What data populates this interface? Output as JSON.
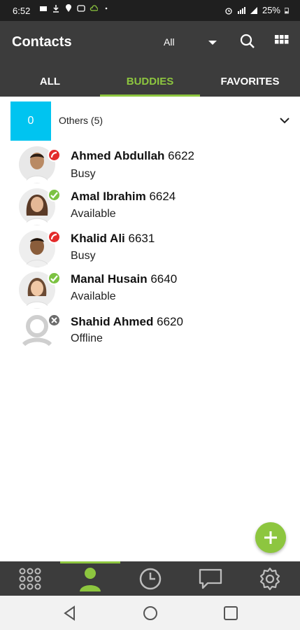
{
  "status_bar": {
    "time": "6:52",
    "battery": "25%"
  },
  "app_bar": {
    "title": "Contacts",
    "filter_value": "All"
  },
  "tabs": [
    {
      "label": "ALL"
    },
    {
      "label": "BUDDIES"
    },
    {
      "label": "FAVORITES"
    }
  ],
  "group": {
    "count": "0",
    "label": "Others (5)"
  },
  "contacts": [
    {
      "name": "Ahmed Abdullah",
      "ext": "6622",
      "status": "Busy"
    },
    {
      "name": "Amal Ibrahim",
      "ext": "6624",
      "status": "Available"
    },
    {
      "name": "Khalid Ali",
      "ext": "6631",
      "status": "Busy"
    },
    {
      "name": "Manal Husain",
      "ext": "6640",
      "status": "Available"
    },
    {
      "name": "Shahid Ahmed",
      "ext": "6620",
      "status": "Offline"
    }
  ],
  "colors": {
    "accent": "#8dc63f",
    "busy": "#e32b2b",
    "available": "#7cc242",
    "offline": "#6b6b6b",
    "group_count_bg": "#00c4f0"
  },
  "bottom_nav": {
    "items": [
      "dialpad-icon",
      "contacts-icon",
      "history-icon",
      "chat-icon",
      "settings-icon"
    ],
    "active": "contacts-icon"
  }
}
